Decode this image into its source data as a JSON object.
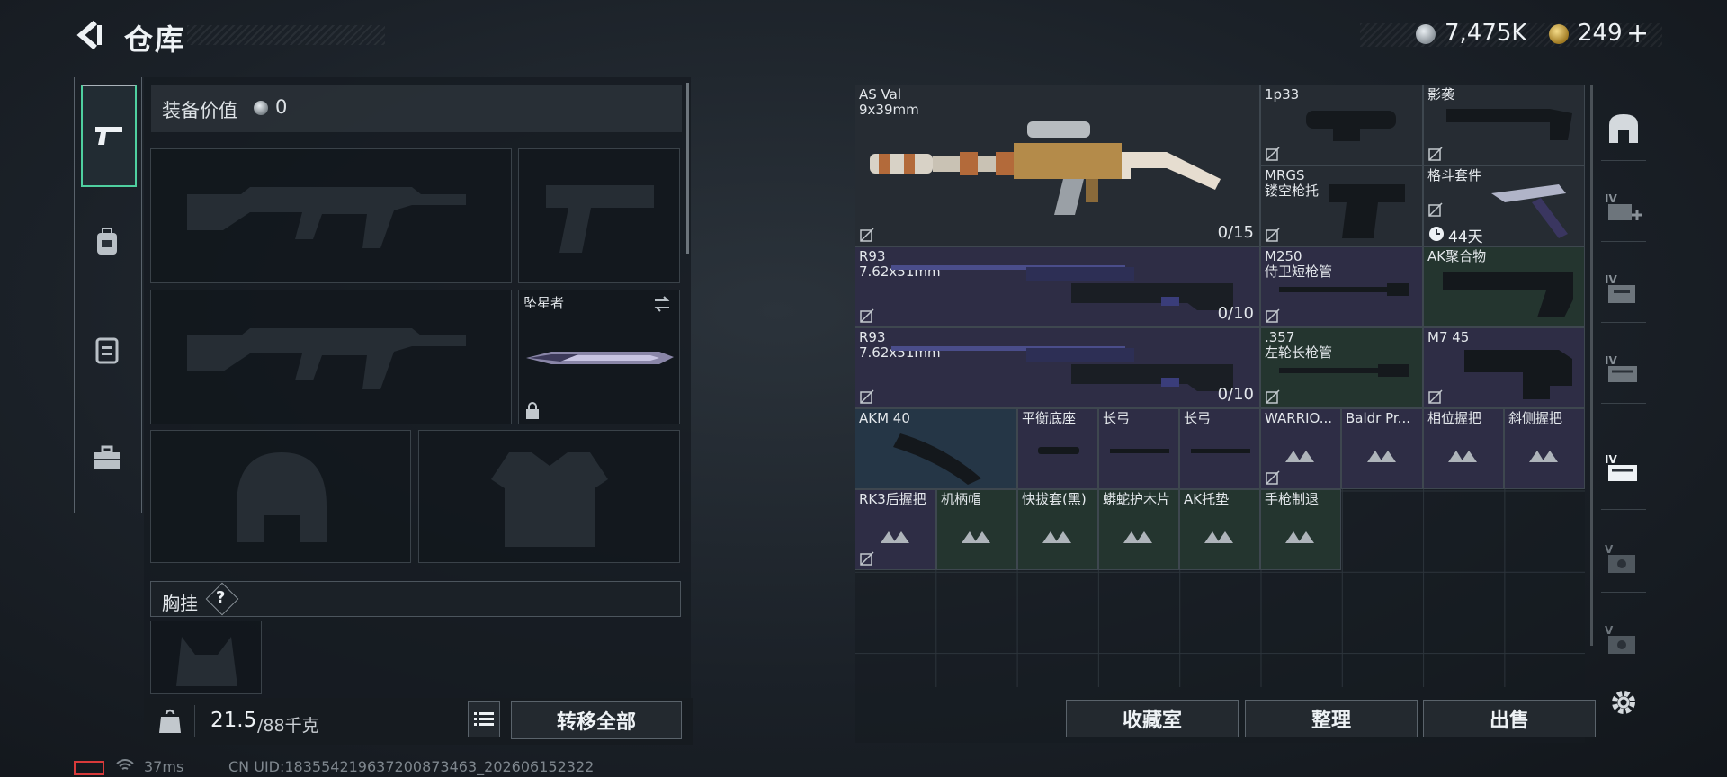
{
  "header": {
    "title": "仓库",
    "currency_silver": "7,475K",
    "currency_gold": "249",
    "add_symbol": "+"
  },
  "left": {
    "equip_value_label": "装备价值",
    "equip_value": "0",
    "melee_name": "坠星者",
    "chest_rig_label": "胸挂",
    "chest_rig_help": "?",
    "weight_current": "21.5",
    "weight_max": "/88千克",
    "transfer_all": "转移全部"
  },
  "items": [
    {
      "name": "AS Val",
      "sub": "9x39mm",
      "count": "0/15"
    },
    {
      "name": "1p33",
      "sub": ""
    },
    {
      "name": "影袭",
      "sub": ""
    },
    {
      "name": "MRGS",
      "sub": "镂空枪托"
    },
    {
      "name": "格斗套件",
      "sub": "",
      "timer": "44天"
    },
    {
      "name": "R93",
      "sub": "7.62x51mm",
      "count": "0/10"
    },
    {
      "name": "M250",
      "sub": "侍卫短枪管"
    },
    {
      "name": "AK聚合物",
      "sub": ""
    },
    {
      "name": "R93",
      "sub": "7.62x51mm",
      "count": "0/10"
    },
    {
      "name": ".357",
      "sub": "左轮长枪管"
    },
    {
      "name": "M7 45",
      "sub": ""
    },
    {
      "name": "AKM 40",
      "sub": ""
    },
    {
      "name": "平衡底座",
      "sub": ""
    },
    {
      "name": "长弓",
      "sub": ""
    },
    {
      "name": "长弓",
      "sub": ""
    },
    {
      "name": "WARRIO...",
      "sub": ""
    },
    {
      "name": "Baldr Pr...",
      "sub": ""
    },
    {
      "name": "相位握把",
      "sub": ""
    },
    {
      "name": "斜侧握把",
      "sub": ""
    },
    {
      "name": "RK3后握把",
      "sub": ""
    },
    {
      "name": "机柄帽",
      "sub": ""
    },
    {
      "name": "快拔套(黑)",
      "sub": ""
    },
    {
      "name": "蟒蛇护木片",
      "sub": ""
    },
    {
      "name": "AK托垫",
      "sub": ""
    },
    {
      "name": "手枪制退",
      "sub": ""
    }
  ],
  "actions": {
    "collection": "收藏室",
    "organize": "整理",
    "sell": "出售"
  },
  "right_tabs": [
    "IV",
    "IV",
    "IV",
    "IV",
    "V",
    "V"
  ],
  "status": {
    "ping": "37ms",
    "uid": "CN UID:1835542196372008734​63_202606152322"
  },
  "colors": {
    "accent_green": "#4fd0a0",
    "purple_tile": "#2e2d45",
    "green_tile": "#24352f"
  }
}
